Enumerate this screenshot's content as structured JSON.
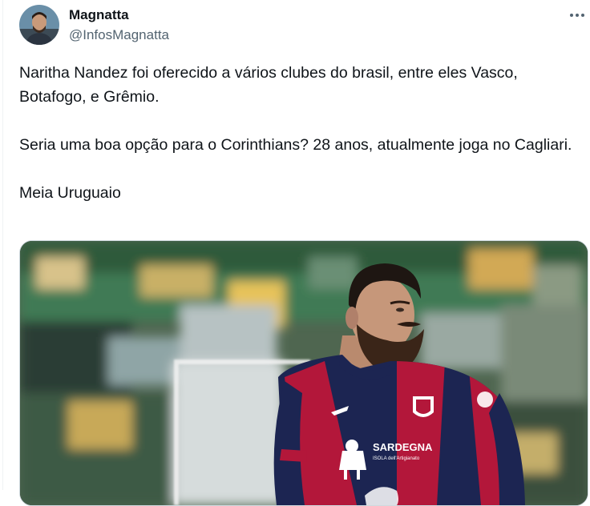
{
  "author": {
    "name": "Magnatta",
    "handle": "@InfosMagnatta",
    "avatar_icon": "profile-photo"
  },
  "menu": {
    "icon": "more-horizontal-icon"
  },
  "tweet": {
    "paragraphs": [
      "Naritha Nandez foi oferecido a vários clubes do brasil, entre eles Vasco, Botafogo, e Grêmio.",
      "Seria uma boa opção para o Corinthians? 28 anos, atualmente joga no Cagliari.",
      "Meia Uruguaio"
    ]
  },
  "media": {
    "description_icon": "football-player-photo",
    "shirt_sponsor": "SARDEGNA",
    "shirt_sponsor_sub": "ISOLA dell'Artigianato",
    "colors": {
      "navy": "#1c2552",
      "red": "#b3173a",
      "pitch": "#3d7a4a"
    }
  }
}
